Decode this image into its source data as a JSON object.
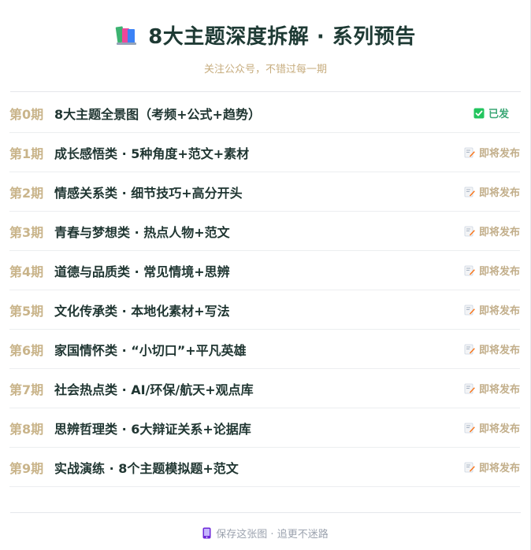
{
  "header": {
    "title": "8大主题深度拆解 · 系列预告",
    "subtitle": "关注公众号，不错过每一期",
    "icon": "books-icon"
  },
  "colors": {
    "period": "#c9b48a",
    "topic": "#1f3531",
    "done": "#3ba776",
    "soon": "#c2ae8a"
  },
  "items": [
    {
      "period": "第0期",
      "topic": "8大主题全景图（考频+公式+趋势）",
      "status": "已发",
      "state": "done",
      "icon": "check-box-icon"
    },
    {
      "period": "第1期",
      "topic": "成长感悟类 · 5种角度+范文+素材",
      "status": "即将发布",
      "state": "soon",
      "icon": "memo-icon"
    },
    {
      "period": "第2期",
      "topic": "情感关系类 · 细节技巧+高分开头",
      "status": "即将发布",
      "state": "soon",
      "icon": "memo-icon"
    },
    {
      "period": "第3期",
      "topic": "青春与梦想类 · 热点人物+范文",
      "status": "即将发布",
      "state": "soon",
      "icon": "memo-icon"
    },
    {
      "period": "第4期",
      "topic": "道德与品质类 · 常见情境+思辨",
      "status": "即将发布",
      "state": "soon",
      "icon": "memo-icon"
    },
    {
      "period": "第5期",
      "topic": "文化传承类 · 本地化素材+写法",
      "status": "即将发布",
      "state": "soon",
      "icon": "memo-icon"
    },
    {
      "period": "第6期",
      "topic": "家国情怀类 · “小切口”+平凡英雄",
      "status": "即将发布",
      "state": "soon",
      "icon": "memo-icon"
    },
    {
      "period": "第7期",
      "topic": "社会热点类 · AI/环保/航天+观点库",
      "status": "即将发布",
      "state": "soon",
      "icon": "memo-icon"
    },
    {
      "period": "第8期",
      "topic": "思辨哲理类 · 6大辩证关系+论据库",
      "status": "即将发布",
      "state": "soon",
      "icon": "memo-icon"
    },
    {
      "period": "第9期",
      "topic": "实战演练 · 8个主题模拟题+范文",
      "status": "即将发布",
      "state": "soon",
      "icon": "memo-icon"
    }
  ],
  "footer": {
    "text": "保存这张图 · 追更不迷路",
    "icon": "phone-icon"
  }
}
